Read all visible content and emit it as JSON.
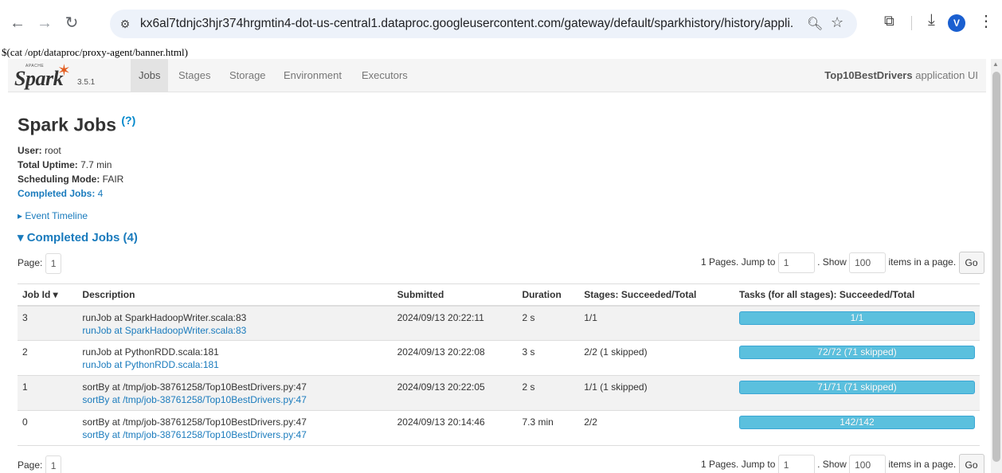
{
  "browser": {
    "url": "kx6al7tdnjc3hjr374hrgmtin4-dot-us-central1.dataproc.googleusercontent.com/gateway/default/sparkhistory/history/appli...",
    "profile_initial": "V"
  },
  "banner": "$(cat /opt/dataproc/proxy-agent/banner.html)",
  "spark": {
    "apache": "APACHE",
    "logo_word": "Spark",
    "version": "3.5.1",
    "tabs": [
      "Jobs",
      "Stages",
      "Storage",
      "Environment",
      "Executors"
    ],
    "active_tab": "Jobs",
    "app_name": "Top10BestDrivers",
    "app_suffix": " application UI"
  },
  "page": {
    "title": "Spark Jobs",
    "help": "(?)",
    "summary": {
      "user_label": "User:",
      "user": " root",
      "uptime_label": "Total Uptime:",
      "uptime": " 7.7 min",
      "mode_label": "Scheduling Mode:",
      "mode": " FAIR",
      "completed_label": "Completed Jobs:",
      "completed": " 4"
    },
    "event_timeline": "▸ Event Timeline",
    "section_title": "▾ Completed Jobs (4)"
  },
  "pager": {
    "page_label": "Page:",
    "page": "1",
    "pages_text": "1 Pages. Jump to",
    "jump_value": "1",
    "show_text": ". Show",
    "show_value": "100",
    "items_text": "items in a page.",
    "go": "Go"
  },
  "table": {
    "headers": [
      "Job Id ▾",
      "Description",
      "Submitted",
      "Duration",
      "Stages: Succeeded/Total",
      "Tasks (for all stages): Succeeded/Total"
    ],
    "rows": [
      {
        "id": "3",
        "desc": "runJob at SparkHadoopWriter.scala:83",
        "desc_link": "runJob at SparkHadoopWriter.scala:83",
        "submitted": "2024/09/13 20:22:11",
        "duration": "2 s",
        "stages": "1/1",
        "tasks": "1/1",
        "progress": 1.0
      },
      {
        "id": "2",
        "desc": "runJob at PythonRDD.scala:181",
        "desc_link": "runJob at PythonRDD.scala:181",
        "submitted": "2024/09/13 20:22:08",
        "duration": "3 s",
        "stages": "2/2 (1 skipped)",
        "tasks": "72/72 (71 skipped)",
        "progress": 1.0
      },
      {
        "id": "1",
        "desc": "sortBy at /tmp/job-38761258/Top10BestDrivers.py:47",
        "desc_link": "sortBy at /tmp/job-38761258/Top10BestDrivers.py:47",
        "submitted": "2024/09/13 20:22:05",
        "duration": "2 s",
        "stages": "1/1 (1 skipped)",
        "tasks": "71/71 (71 skipped)",
        "progress": 1.0
      },
      {
        "id": "0",
        "desc": "sortBy at /tmp/job-38761258/Top10BestDrivers.py:47",
        "desc_link": "sortBy at /tmp/job-38761258/Top10BestDrivers.py:47",
        "submitted": "2024/09/13 20:14:46",
        "duration": "7.3 min",
        "stages": "2/2",
        "tasks": "142/142",
        "progress": 1.0
      }
    ]
  },
  "colors": {
    "link": "#1a7bbd",
    "progress": "#5bc0de",
    "spark_orange": "#e25a1c"
  }
}
